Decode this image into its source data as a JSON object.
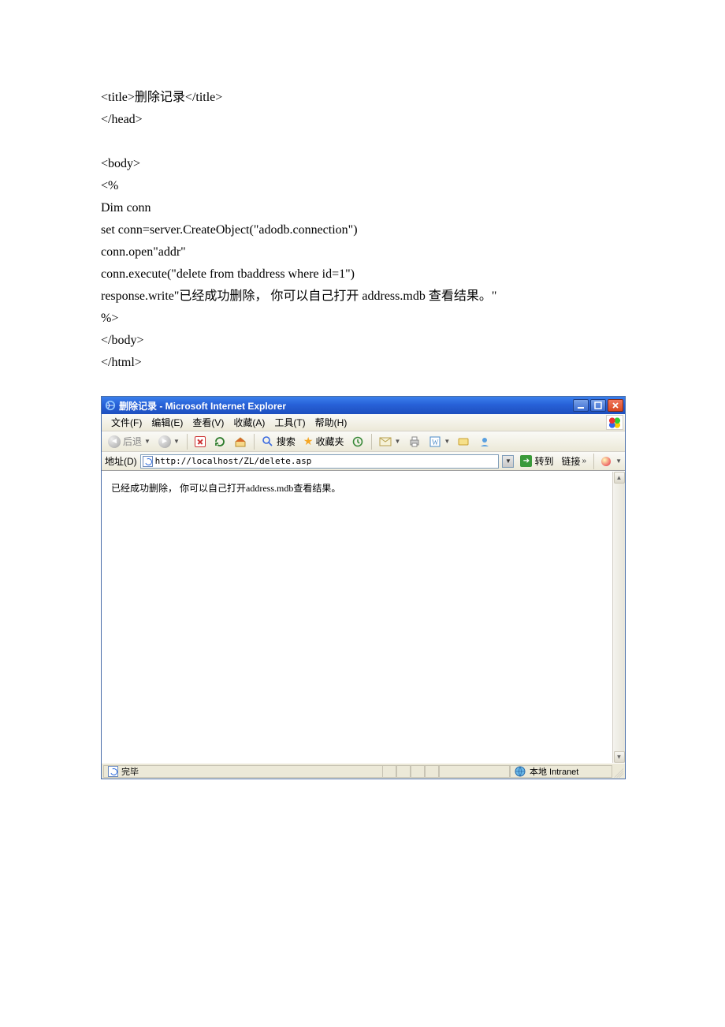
{
  "code": {
    "line1": "<title>删除记录</title>",
    "line2": "</head>",
    "line3": "<body>",
    "line4": "<%",
    "line5": "Dim conn",
    "line6": "set conn=server.CreateObject(\"adodb.connection\")",
    "line7": "conn.open\"addr\"",
    "line8": "conn.execute(\"delete from tbaddress where id=1\")",
    "line9": "response.write\"已经成功删除，  你可以自己打开 address.mdb 查看结果。\"",
    "line10": "%>",
    "line11": "</body>",
    "line12": "</html>"
  },
  "browser": {
    "title": "删除记录 - Microsoft Internet Explorer",
    "menu": {
      "file": "文件(F)",
      "edit": "编辑(E)",
      "view": "查看(V)",
      "fav": "收藏(A)",
      "tools": "工具(T)",
      "help": "帮助(H)"
    },
    "toolbar": {
      "back": "后退",
      "search": "搜索",
      "favorites": "收藏夹"
    },
    "address": {
      "label": "地址(D)",
      "value": "http://localhost/ZL/delete.asp",
      "go": "转到",
      "links": "链接"
    },
    "page_text": "已经成功删除，  你可以自己打开address.mdb查看结果。",
    "status": {
      "done": "完毕",
      "zone": "本地 Intranet"
    }
  }
}
